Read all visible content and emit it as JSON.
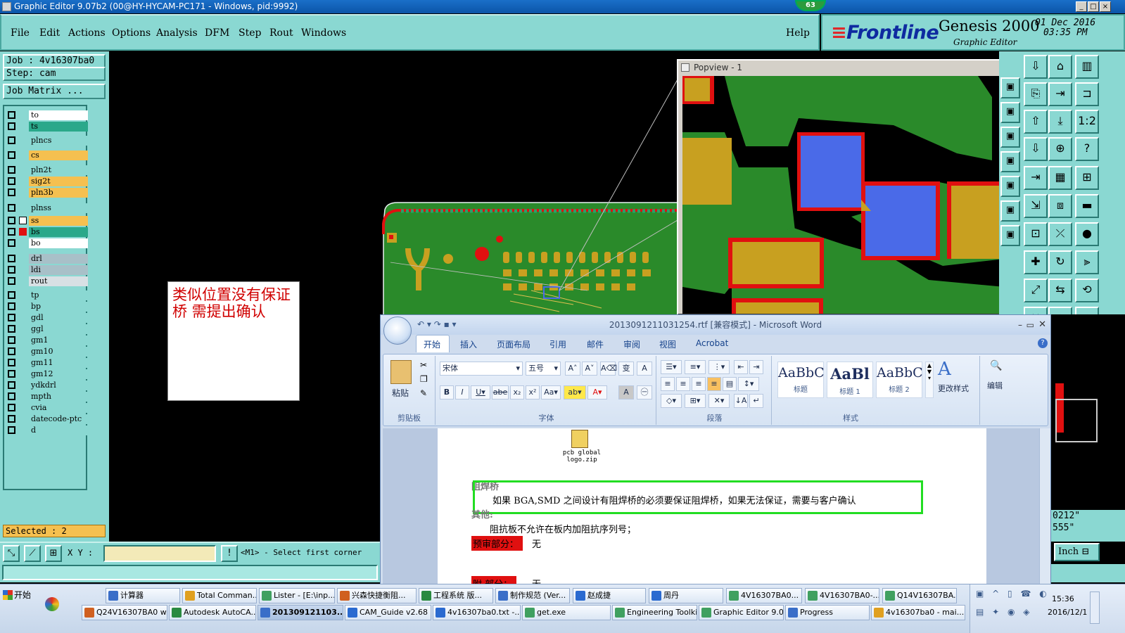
{
  "window": {
    "title": "Graphic Editor 9.07b2 (00@HY-HYCAM-PC171 - Windows, pid:9992)",
    "badge": "63"
  },
  "menu": [
    "File",
    "Edit",
    "Actions",
    "Options",
    "Analysis",
    "DFM",
    "Step",
    "Rout",
    "Windows"
  ],
  "help": "Help",
  "brand": {
    "logo": "Frontline",
    "product": "Genesis 2000",
    "subtitle": "Graphic Editor",
    "date": "01 Dec 2016",
    "time": "03:35 PM"
  },
  "job": {
    "job_label": "Job : 4v16307ba0",
    "step_label": "Step: cam",
    "matrix_button": "Job Matrix ..."
  },
  "layers": [
    {
      "name": "to",
      "color": "#ffffff"
    },
    {
      "name": "ts",
      "color": "#2aa88a"
    },
    {
      "name": "plncs",
      "color": "#8ad8d2"
    },
    {
      "name": "cs",
      "color": "#f5c050"
    },
    {
      "name": "pln2t",
      "color": "#8ad8d2"
    },
    {
      "name": "sig2t",
      "color": "#f5c050"
    },
    {
      "name": "pln3b",
      "color": "#f5c050"
    },
    {
      "name": "plnss",
      "color": "#8ad8d2"
    },
    {
      "name": "ss",
      "color": "#f5c050"
    },
    {
      "name": "bs",
      "color": "#2aa88a"
    },
    {
      "name": "bo",
      "color": "#ffffff"
    },
    {
      "name": "drl",
      "color": "#a8c0c8"
    },
    {
      "name": "ldi",
      "color": "#a8c0c8"
    },
    {
      "name": "rout",
      "color": "#d8e0e4"
    },
    {
      "name": "tp",
      "color": "#8ad8d2"
    },
    {
      "name": "bp",
      "color": "#8ad8d2"
    },
    {
      "name": "gdl",
      "color": "#8ad8d2"
    },
    {
      "name": "ggl",
      "color": "#8ad8d2"
    },
    {
      "name": "gm1",
      "color": "#8ad8d2"
    },
    {
      "name": "gm10",
      "color": "#8ad8d2"
    },
    {
      "name": "gm11",
      "color": "#8ad8d2"
    },
    {
      "name": "gm12",
      "color": "#8ad8d2"
    },
    {
      "name": "ydkdrl",
      "color": "#8ad8d2"
    },
    {
      "name": "mpth",
      "color": "#8ad8d2"
    },
    {
      "name": "cvia",
      "color": "#8ad8d2"
    },
    {
      "name": "datecode-ptc",
      "color": "#8ad8d2"
    },
    {
      "name": "d",
      "color": "#8ad8d2"
    }
  ],
  "selected": "Selected : 2",
  "command": {
    "xy_label": "X Y :",
    "prompt": "<M1> - Select first corner",
    "x_input": ""
  },
  "popview": {
    "title": "Popview - 1"
  },
  "note": "类似位置没有保证桥  需提出确认",
  "word": {
    "title": "2013091211031254.rtf [兼容模式] - Microsoft Word",
    "tabs": [
      "开始",
      "插入",
      "页面布局",
      "引用",
      "邮件",
      "审阅",
      "视图",
      "Acrobat"
    ],
    "groups": {
      "clipboard": "剪贴板",
      "font": "字体",
      "paragraph": "段落",
      "styles": "样式"
    },
    "paste": "粘贴",
    "font_name": "宋体",
    "font_size": "五号",
    "styles": [
      {
        "preview": "AaBbC",
        "name": "标题"
      },
      {
        "preview": "AaBl",
        "name": "标题 1"
      },
      {
        "preview": "AaBbC",
        "name": "标题 2"
      }
    ],
    "change_styles": "更改样式",
    "editing": "编辑",
    "attachment": "pcb global logo.zip",
    "heading_partial": "阻焊桥",
    "line1": "如果 BGA,SMD 之间设计有阻焊桥的必须要保证阻焊桥，如果无法保证，需要与客户确认",
    "heading2_partial": "其他:",
    "line2": "阻抗板不允许在板内加阻抗序列号；",
    "review_label": "预审部分：",
    "review_value": "无",
    "last_partial": "附 部分：",
    "last_value": "无"
  },
  "right_fragments": {
    "coord1": "0212\"",
    "coord2": "555\"",
    "units": "Inch"
  },
  "taskbar": {
    "start": "开始",
    "row1": [
      "计算器",
      "Total Comman...",
      "Lister - [E:\\inp...",
      "兴森快捷衡阻...",
      "工程系统 版...",
      "制作规范 (Ver...",
      "赵成捷",
      "周丹",
      "4V16307BA0...",
      "4V16307BA0-...",
      "Q14V16307BA..."
    ],
    "row2": [
      "Q24V16307BA0 w...",
      "Autodesk AutoCA...",
      "201309121103...",
      "CAM_Guide v2.68",
      "4v16307ba0.txt -...",
      "get.exe",
      "Engineering Toolki...",
      "Graphic Editor 9.0...",
      "Progress",
      "4v16307ba0 - mai..."
    ],
    "clock_time": "15:36",
    "clock_date": "2016/12/1"
  },
  "colors": {
    "panel": "#8ad8d2",
    "pcb_green": "#2a8a2a",
    "pad_gold": "#c8a020",
    "pad_blue": "#4a6ae8",
    "mask_red": "#e01010",
    "highlight_green": "#22dd22"
  }
}
